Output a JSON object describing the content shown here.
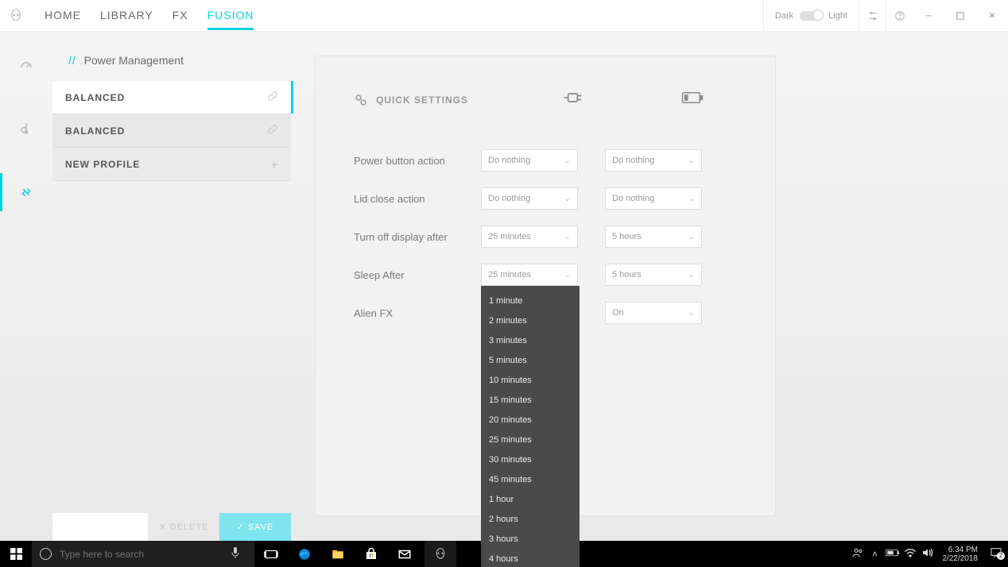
{
  "app": {
    "tabs": [
      "HOME",
      "LIBRARY",
      "FX",
      "FUSION"
    ],
    "active_tab": 3,
    "theme_dark": "Dark",
    "theme_light": "Light"
  },
  "breadcrumb": {
    "slashes": "//",
    "title": "Power Management"
  },
  "profiles": {
    "items": [
      {
        "label": "BALANCED",
        "active": true,
        "icon": "link"
      },
      {
        "label": "BALANCED",
        "active": false,
        "icon": "link"
      },
      {
        "label": "NEW PROFILE",
        "active": false,
        "icon": "plus"
      }
    ]
  },
  "actions": {
    "delete": "DELETE",
    "save": "SAVE"
  },
  "quick_settings": {
    "title": "QUICK SETTINGS",
    "rows": [
      {
        "label": "Power button action",
        "ac": "Do nothing",
        "bat": "Do nothing"
      },
      {
        "label": "Lid close action",
        "ac": "Do nothing",
        "bat": "Do nothing"
      },
      {
        "label": "Turn off display after",
        "ac": "25 minutes",
        "bat": "5 hours"
      },
      {
        "label": "Sleep After",
        "ac": "25 minutes",
        "bat": "5 hours",
        "ac_open": true
      },
      {
        "label": "Alien FX",
        "ac": "",
        "bat": "On",
        "ac_hidden": true
      }
    ],
    "dropdown_options": [
      "1 minute",
      "2 minutes",
      "3 minutes",
      "5 minutes",
      "10 minutes",
      "15 minutes",
      "20 minutes",
      "25 minutes",
      "30 minutes",
      "45 minutes",
      "1 hour",
      "2 hours",
      "3 hours",
      "4 hours"
    ]
  },
  "taskbar": {
    "search_placeholder": "Type here to search",
    "time": "6:34 PM",
    "date": "2/22/2018",
    "notif_count": "2"
  }
}
